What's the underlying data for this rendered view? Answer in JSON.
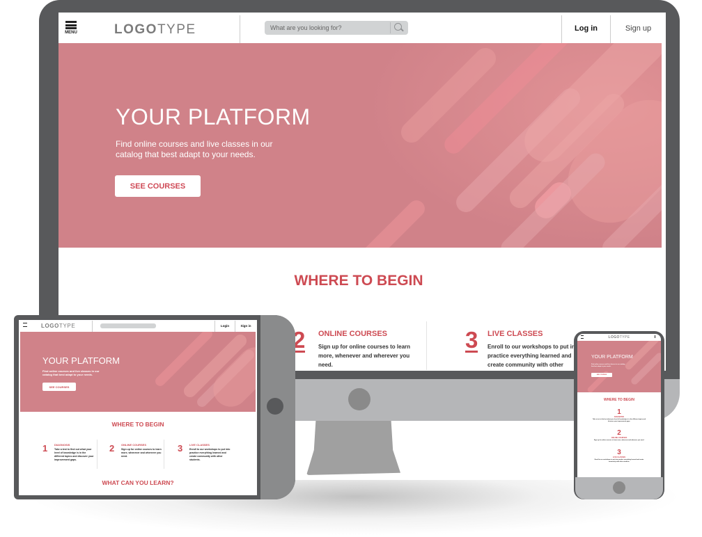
{
  "brand": {
    "logo_bold": "LOGO",
    "logo_light": "TYPE",
    "accent_color": "#cd4a52",
    "hero_color": "#d08289"
  },
  "desktop": {
    "nav": {
      "menu_label": "MENU",
      "search_placeholder": "What are you looking for?",
      "login_label": "Log in",
      "signup_label": "Sign up"
    },
    "hero": {
      "title": "YOUR PLATFORM",
      "subtitle": "Find online courses and live classes in our catalog that best adapt to your needs.",
      "cta_label": "SEE COURSES"
    },
    "where_to_begin": {
      "heading": "WHERE TO BEGIN",
      "steps": [
        {
          "number": "2",
          "title": "ONLINE COURSES",
          "text": "Sign up for online courses to learn more, whenever and wherever you need."
        },
        {
          "number": "3",
          "title": "LIVE CLASSES",
          "text": "Enroll to our workshops  to put in practice everything learned and create community with other students."
        }
      ]
    }
  },
  "tablet": {
    "nav": {
      "login_label": "Login",
      "signup_label": "Sign in"
    },
    "hero": {
      "title": "YOUR PLATFORM",
      "subtitle": "Find online courses and live classes in our catalog that best adapt to your needs.",
      "cta_label": "SEE COURSES"
    },
    "where_to_begin": {
      "heading": "WHERE TO BEGIN",
      "steps": [
        {
          "number": "1",
          "title": "DIAGNOSIS",
          "text": "Take a test to find out what your level of knowledge is in the different topics and discover your improvement gaps."
        },
        {
          "number": "2",
          "title": "ONLINE COURSES",
          "text": "Sign up for online courses to learn more, whenever and wherever you need."
        },
        {
          "number": "3",
          "title": "LIVE CLASSES",
          "text": "Enroll to our workshops  to put into practice everything learned and create community with other students."
        }
      ]
    },
    "next_heading": "WHAT CAN YOU LEARN?"
  },
  "phone": {
    "hero": {
      "title": "YOUR PLATFORM",
      "subtitle": "Find online courses and live classes in our catalog that best adapt to your needs.",
      "cta_label": "SEE COURSES"
    },
    "where_to_begin": {
      "heading": "WHERE TO BEGIN",
      "steps": [
        {
          "number": "1",
          "title": "DIAGNOSIS",
          "text": "Take a test to find out what your level of knowledge is in the different topics and discover your improvement gaps."
        },
        {
          "number": "2",
          "title": "ONLINE COURSES",
          "text": "Sign up for online courses to learn more, whenever and wherever you need."
        },
        {
          "number": "3",
          "title": "LIVE CLASSES",
          "text": "Enroll to our workshops to put into practice everything learned and create community with other students."
        }
      ]
    }
  }
}
